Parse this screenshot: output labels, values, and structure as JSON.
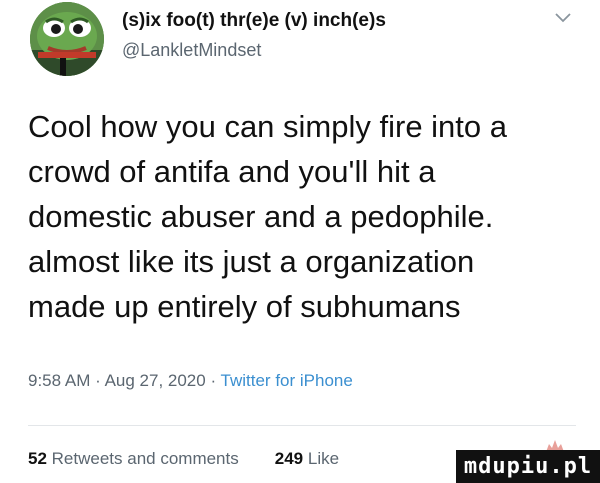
{
  "header": {
    "display_name": "(s)ix foo(t) thr(e)e (v) inch(e)s",
    "handle": "@LankletMindset",
    "avatar_icon": "frog-avatar-icon",
    "menu_icon": "chevron-down-icon"
  },
  "tweet": {
    "lines": [
      "Cool how you can simply fire into a",
      "crowd of antifa and you'll hit a",
      "domestic abuser and a pedophile.",
      "almost like its just a organization",
      "made up entirely of subhumans"
    ]
  },
  "meta": {
    "time": "9:58 AM",
    "date": "Aug 27, 2020",
    "source": "Twitter for iPhone"
  },
  "stats": {
    "retweets_count": "52",
    "retweets_label": "Retweets and comments",
    "likes_count": "249",
    "likes_label": "Like"
  },
  "watermark": {
    "text": "mdupiu.pl"
  },
  "colors": {
    "secondary_text": "#5b6670",
    "source_link": "#3b8fd0",
    "watermark_bg": "#111111"
  }
}
